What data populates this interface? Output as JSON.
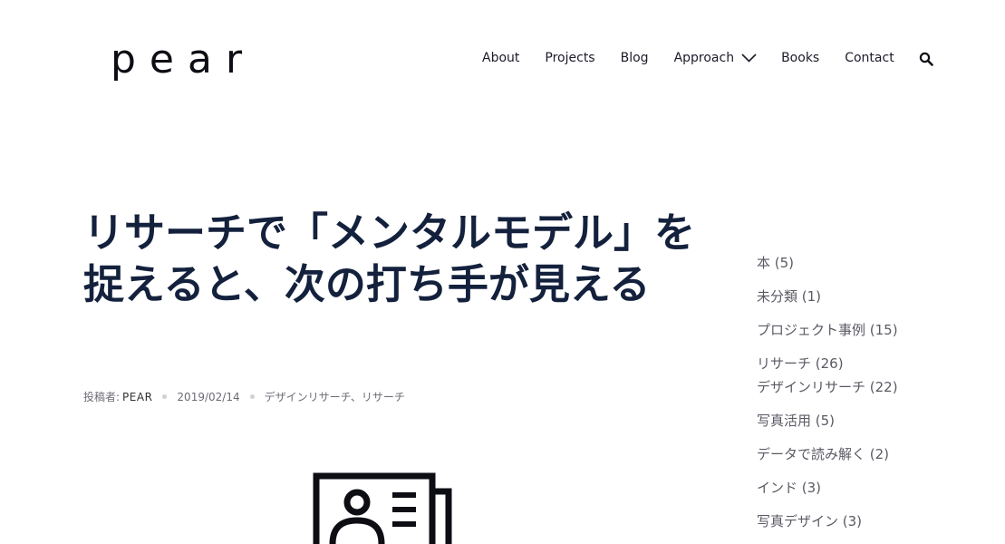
{
  "header": {
    "logo": "pear",
    "nav": [
      {
        "label": "About"
      },
      {
        "label": "Projects"
      },
      {
        "label": "Blog"
      },
      {
        "label": "Approach"
      },
      {
        "label": "Books"
      },
      {
        "label": "Contact"
      }
    ],
    "search_icon": "search-icon"
  },
  "article": {
    "title": "リサーチで「メンタルモデル」を捉えると、次の打ち手が見える",
    "author_label": "投稿者:",
    "author": "PEAR",
    "date": "2019/02/14",
    "categories": "デザインリサーチ、リサーチ"
  },
  "sidebar": {
    "categories": [
      {
        "label": "本 (5)"
      },
      {
        "label": "未分類 (1)"
      },
      {
        "label": "プロジェクト事例 (15)"
      },
      {
        "label": "リサーチ (26)"
      },
      {
        "label": "デザインリサーチ (22)"
      },
      {
        "label": "写真活用 (5)"
      },
      {
        "label": "データで読み解く (2)"
      },
      {
        "label": "インド (3)"
      },
      {
        "label": "写真デザイン (3)"
      }
    ]
  },
  "colors": {
    "title": "#14213d",
    "text": "#1b1b2b",
    "muted": "#6b6b76",
    "background": "#ffffff"
  }
}
